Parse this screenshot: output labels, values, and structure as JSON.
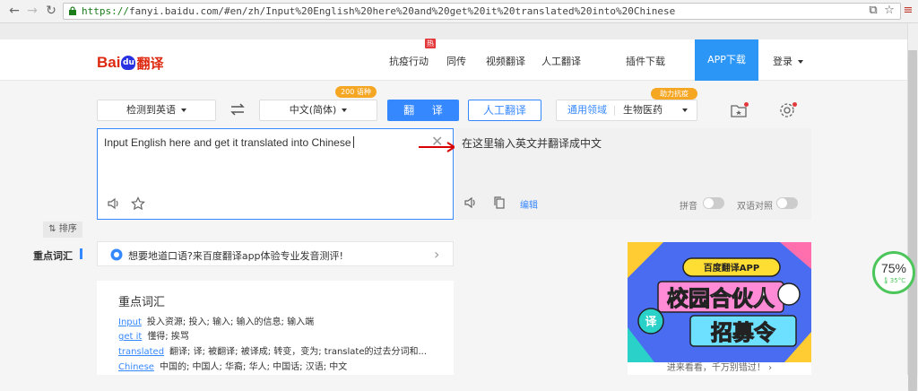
{
  "browser": {
    "url_scheme": "https://",
    "url_rest": "fanyi.baidu.com/#en/zh/Input%20English%20here%20and%20get%20it%20translated%20into%20Chinese",
    "icons": [
      "back-icon",
      "forward-icon",
      "reload-icon",
      "lock-icon",
      "translate-page-icon",
      "bookmark-star-icon",
      "menu-icon"
    ]
  },
  "header": {
    "logo_bai": "Bai",
    "logo_du": "du",
    "logo_fanyi": "翻译",
    "nav": [
      "抗疫行动",
      "同传",
      "视频翻译",
      "人工翻译",
      "插件下载"
    ],
    "hot_badge": "热",
    "app_download": "APP下载",
    "login": "登录"
  },
  "toolbar": {
    "source_lang": "检测到英语",
    "target_lang": "中文(简体)",
    "badge_200": "200 语种",
    "translate_label": "翻 译",
    "human_label": "人工翻译",
    "domain_label": "通用领域",
    "domain_value": "生物医药",
    "help_badge": "助力抗疫"
  },
  "input": {
    "text": "Input English here and get it translated into Chinese"
  },
  "output": {
    "text": "在这里输入英文并翻译成中文",
    "edit_label": "编辑",
    "pinyin_label": "拼音",
    "bilingual_label": "双语对照"
  },
  "sidebar": {
    "sort_label": "排序",
    "vocab_label": "重点词汇"
  },
  "promo": {
    "text": "想要地道口语?来百度翻译app体验专业发音测评!"
  },
  "vocab": {
    "title": "重点词汇",
    "rows": [
      {
        "word": "Input",
        "meaning": "投入资源; 投入; 输入; 输入的信息; 输入端"
      },
      {
        "word": "get it",
        "meaning": "懂得; 挨骂"
      },
      {
        "word": "translated",
        "meaning": "翻译; 译; 被翻译; 被译成; 转变，变为; translate的过去分词和..."
      },
      {
        "word": "Chinese",
        "meaning": "中国的; 中国人; 华裔; 华人; 中国话; 汉语; 中文"
      }
    ]
  },
  "ad": {
    "app_title": "百度翻译APP",
    "headline1": "校园合伙人",
    "headline2": "招募令",
    "char": "译",
    "footer": "进来看看，千万别错过！"
  },
  "gauge": {
    "value": "75%",
    "temp": "35°C"
  },
  "colors": {
    "accent": "#3688ff",
    "brand_red": "#de2910",
    "app_blue": "#2b96f5"
  }
}
